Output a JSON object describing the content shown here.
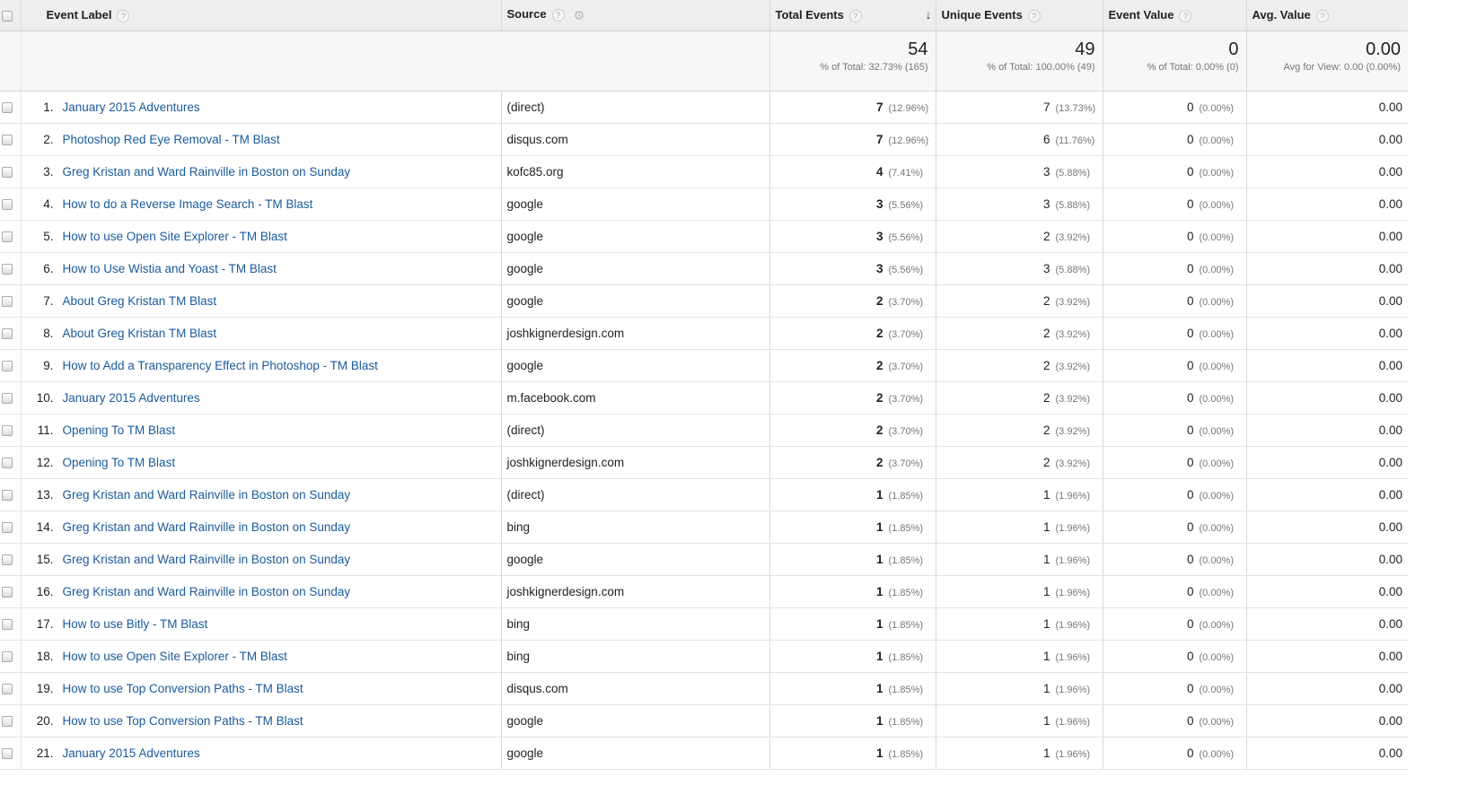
{
  "headers": {
    "event_label": "Event Label",
    "source": "Source",
    "total_events": "Total Events",
    "unique_events": "Unique Events",
    "event_value": "Event Value",
    "avg_value": "Avg. Value",
    "help": "?"
  },
  "totals": {
    "total_events": "54",
    "total_events_sub": "% of Total: 32.73% (165)",
    "unique_events": "49",
    "unique_events_sub": "% of Total: 100.00% (49)",
    "event_value": "0",
    "event_value_sub": "% of Total: 0.00% (0)",
    "avg_value": "0.00",
    "avg_value_sub": "Avg for View: 0.00 (0.00%)"
  },
  "rows": [
    {
      "n": "1.",
      "label": "January 2015 Adventures",
      "source": "(direct)",
      "tot": "7",
      "totp": "(12.96%)",
      "uni": "7",
      "unip": "(13.73%)",
      "val": "0",
      "valp": "(0.00%)",
      "avg": "0.00"
    },
    {
      "n": "2.",
      "label": "Photoshop Red Eye Removal - TM Blast",
      "source": "disqus.com",
      "tot": "7",
      "totp": "(12.96%)",
      "uni": "6",
      "unip": "(11.76%)",
      "val": "0",
      "valp": "(0.00%)",
      "avg": "0.00"
    },
    {
      "n": "3.",
      "label": "Greg Kristan and Ward Rainville in Boston on Sunday",
      "source": "kofc85.org",
      "tot": "4",
      "totp": "(7.41%)",
      "uni": "3",
      "unip": "(5.88%)",
      "val": "0",
      "valp": "(0.00%)",
      "avg": "0.00"
    },
    {
      "n": "4.",
      "label": "How to do a Reverse Image Search - TM Blast",
      "source": "google",
      "tot": "3",
      "totp": "(5.56%)",
      "uni": "3",
      "unip": "(5.88%)",
      "val": "0",
      "valp": "(0.00%)",
      "avg": "0.00"
    },
    {
      "n": "5.",
      "label": "How to use Open Site Explorer - TM Blast",
      "source": "google",
      "tot": "3",
      "totp": "(5.56%)",
      "uni": "2",
      "unip": "(3.92%)",
      "val": "0",
      "valp": "(0.00%)",
      "avg": "0.00"
    },
    {
      "n": "6.",
      "label": "How to Use Wistia and Yoast - TM Blast",
      "source": "google",
      "tot": "3",
      "totp": "(5.56%)",
      "uni": "3",
      "unip": "(5.88%)",
      "val": "0",
      "valp": "(0.00%)",
      "avg": "0.00"
    },
    {
      "n": "7.",
      "label": "About Greg Kristan TM Blast",
      "source": "google",
      "tot": "2",
      "totp": "(3.70%)",
      "uni": "2",
      "unip": "(3.92%)",
      "val": "0",
      "valp": "(0.00%)",
      "avg": "0.00"
    },
    {
      "n": "8.",
      "label": "About Greg Kristan TM Blast",
      "source": "joshkignerdesign.com",
      "tot": "2",
      "totp": "(3.70%)",
      "uni": "2",
      "unip": "(3.92%)",
      "val": "0",
      "valp": "(0.00%)",
      "avg": "0.00"
    },
    {
      "n": "9.",
      "label": "How to Add a Transparency Effect in Photoshop - TM Blast",
      "source": "google",
      "tot": "2",
      "totp": "(3.70%)",
      "uni": "2",
      "unip": "(3.92%)",
      "val": "0",
      "valp": "(0.00%)",
      "avg": "0.00"
    },
    {
      "n": "10.",
      "label": "January 2015 Adventures",
      "source": "m.facebook.com",
      "tot": "2",
      "totp": "(3.70%)",
      "uni": "2",
      "unip": "(3.92%)",
      "val": "0",
      "valp": "(0.00%)",
      "avg": "0.00"
    },
    {
      "n": "11.",
      "label": "Opening To TM Blast",
      "source": "(direct)",
      "tot": "2",
      "totp": "(3.70%)",
      "uni": "2",
      "unip": "(3.92%)",
      "val": "0",
      "valp": "(0.00%)",
      "avg": "0.00"
    },
    {
      "n": "12.",
      "label": "Opening To TM Blast",
      "source": "joshkignerdesign.com",
      "tot": "2",
      "totp": "(3.70%)",
      "uni": "2",
      "unip": "(3.92%)",
      "val": "0",
      "valp": "(0.00%)",
      "avg": "0.00"
    },
    {
      "n": "13.",
      "label": "Greg Kristan and Ward Rainville in Boston on Sunday",
      "source": "(direct)",
      "tot": "1",
      "totp": "(1.85%)",
      "uni": "1",
      "unip": "(1.96%)",
      "val": "0",
      "valp": "(0.00%)",
      "avg": "0.00"
    },
    {
      "n": "14.",
      "label": "Greg Kristan and Ward Rainville in Boston on Sunday",
      "source": "bing",
      "tot": "1",
      "totp": "(1.85%)",
      "uni": "1",
      "unip": "(1.96%)",
      "val": "0",
      "valp": "(0.00%)",
      "avg": "0.00"
    },
    {
      "n": "15.",
      "label": "Greg Kristan and Ward Rainville in Boston on Sunday",
      "source": "google",
      "tot": "1",
      "totp": "(1.85%)",
      "uni": "1",
      "unip": "(1.96%)",
      "val": "0",
      "valp": "(0.00%)",
      "avg": "0.00"
    },
    {
      "n": "16.",
      "label": "Greg Kristan and Ward Rainville in Boston on Sunday",
      "source": "joshkignerdesign.com",
      "tot": "1",
      "totp": "(1.85%)",
      "uni": "1",
      "unip": "(1.96%)",
      "val": "0",
      "valp": "(0.00%)",
      "avg": "0.00"
    },
    {
      "n": "17.",
      "label": "How to use Bitly - TM Blast",
      "source": "bing",
      "tot": "1",
      "totp": "(1.85%)",
      "uni": "1",
      "unip": "(1.96%)",
      "val": "0",
      "valp": "(0.00%)",
      "avg": "0.00"
    },
    {
      "n": "18.",
      "label": "How to use Open Site Explorer - TM Blast",
      "source": "bing",
      "tot": "1",
      "totp": "(1.85%)",
      "uni": "1",
      "unip": "(1.96%)",
      "val": "0",
      "valp": "(0.00%)",
      "avg": "0.00"
    },
    {
      "n": "19.",
      "label": "How to use Top Conversion Paths - TM Blast",
      "source": "disqus.com",
      "tot": "1",
      "totp": "(1.85%)",
      "uni": "1",
      "unip": "(1.96%)",
      "val": "0",
      "valp": "(0.00%)",
      "avg": "0.00"
    },
    {
      "n": "20.",
      "label": "How to use Top Conversion Paths - TM Blast",
      "source": "google",
      "tot": "1",
      "totp": "(1.85%)",
      "uni": "1",
      "unip": "(1.96%)",
      "val": "0",
      "valp": "(0.00%)",
      "avg": "0.00"
    },
    {
      "n": "21.",
      "label": "January 2015 Adventures",
      "source": "google",
      "tot": "1",
      "totp": "(1.85%)",
      "uni": "1",
      "unip": "(1.96%)",
      "val": "0",
      "valp": "(0.00%)",
      "avg": "0.00"
    }
  ],
  "icons": {
    "help": "help-circle-icon",
    "gear": "gear-icon",
    "sort": "sort-down-arrow-icon",
    "checkbox": "checkbox-icon"
  },
  "colors": {
    "link": "#1a5a9c",
    "header_bg": "#eeeeee",
    "totals_bg": "#f7f7f7"
  }
}
